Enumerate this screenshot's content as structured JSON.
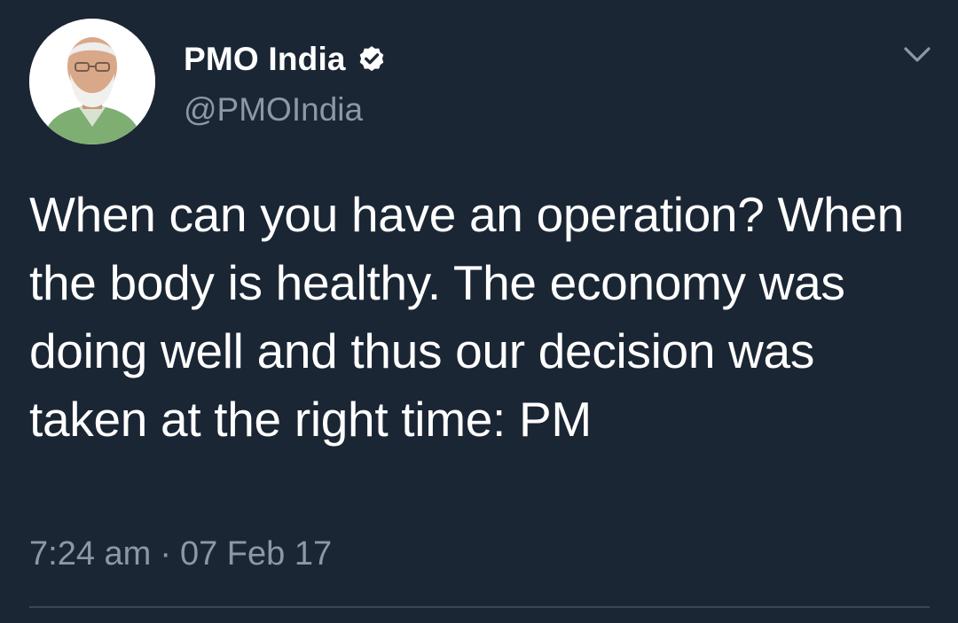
{
  "tweet": {
    "display_name": "PMO India",
    "handle": "@PMOIndia",
    "verified": true,
    "text": "When can you have an operation? When the body is healthy. The economy was doing well and thus our decision was taken at the right time: PM",
    "time": "7:24 am",
    "separator": "·",
    "date": "07 Feb 17"
  },
  "icons": {
    "avatar": "profile-photo",
    "verified": "verified-badge-icon",
    "menu": "chevron-down-icon"
  },
  "colors": {
    "background": "#1b2634",
    "primary_text": "#ffffff",
    "secondary_text": "#8b98a6",
    "divider": "#3a4755"
  }
}
